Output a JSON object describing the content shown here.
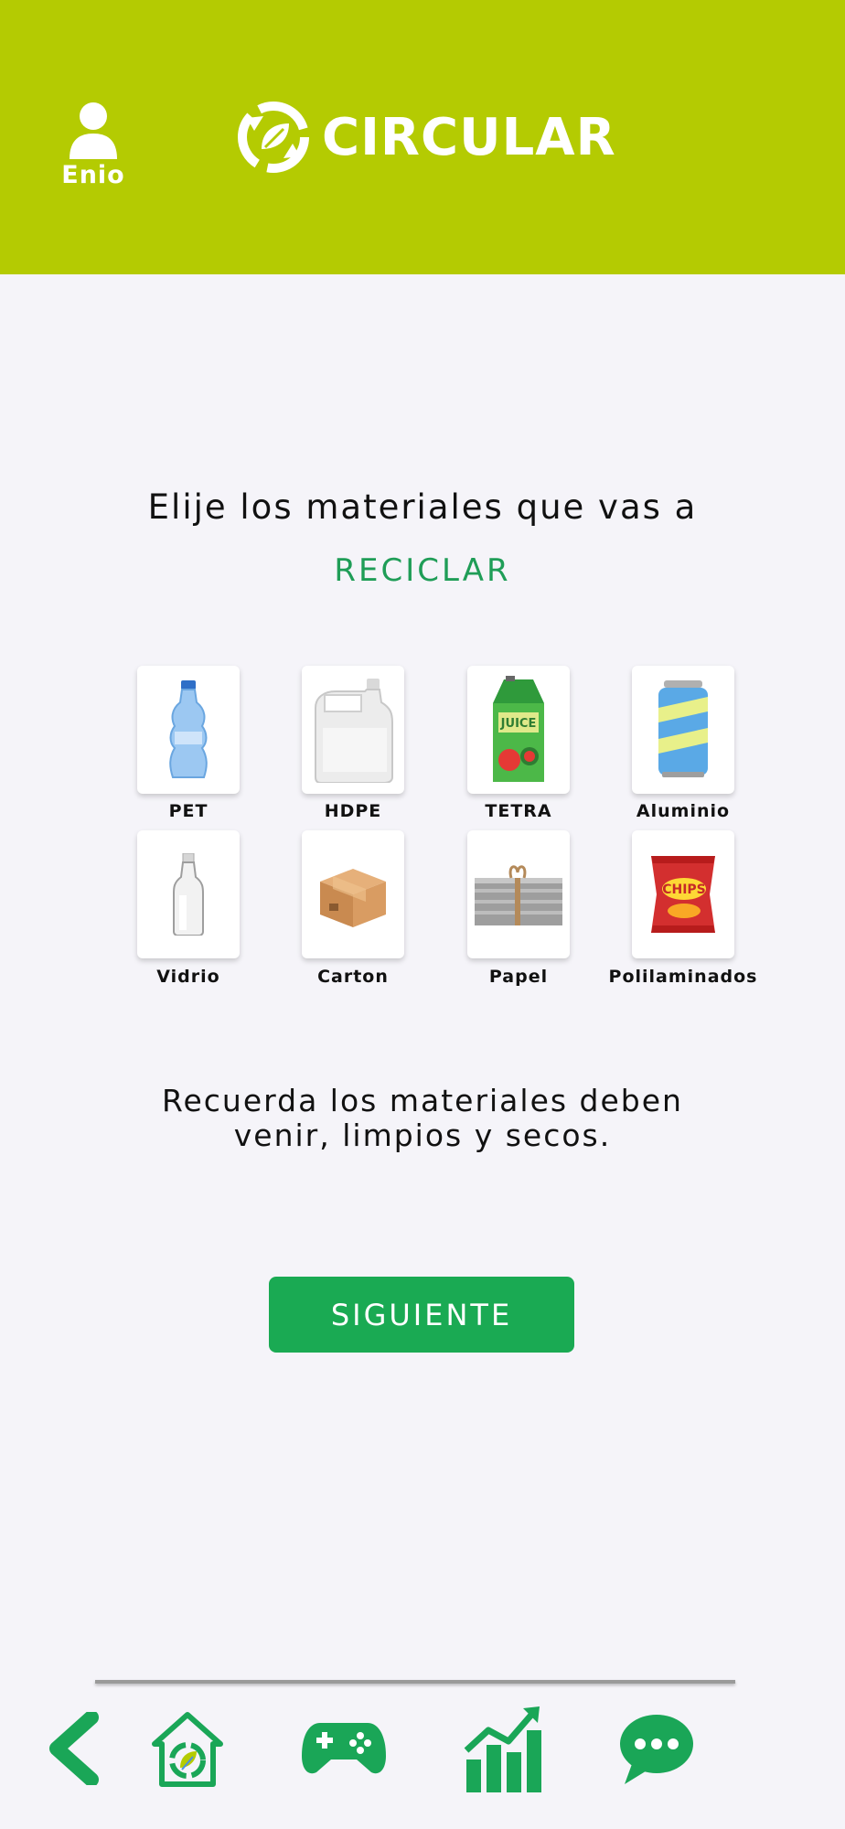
{
  "header": {
    "user_name": "Enio",
    "brand_name": "CIRCULAR",
    "bg_color": "#b4cb02"
  },
  "main": {
    "headline": "Elije los materiales que vas a",
    "accent_word": "RECICLAR",
    "materials": [
      {
        "label": "PET",
        "icon": "plastic-bottle-icon"
      },
      {
        "label": "HDPE",
        "icon": "jug-icon"
      },
      {
        "label": "TETRA",
        "icon": "juice-carton-icon"
      },
      {
        "label": "Aluminio",
        "icon": "soda-can-icon"
      },
      {
        "label": "Vidrio",
        "icon": "glass-bottle-icon"
      },
      {
        "label": "Carton",
        "icon": "cardboard-box-icon"
      },
      {
        "label": "Papel",
        "icon": "newspaper-stack-icon"
      },
      {
        "label": "Polilaminados",
        "icon": "chips-bag-icon"
      }
    ],
    "note_line1": "Recuerda los materiales deben",
    "note_line2": "venir, limpios y secos.",
    "next_button": "SIGUIENTE",
    "accent_color": "#1aaa53"
  },
  "bottom_nav": {
    "items": [
      "back-arrow-icon",
      "home-recycle-icon",
      "gamepad-icon",
      "stats-chart-icon",
      "chat-icon"
    ]
  }
}
